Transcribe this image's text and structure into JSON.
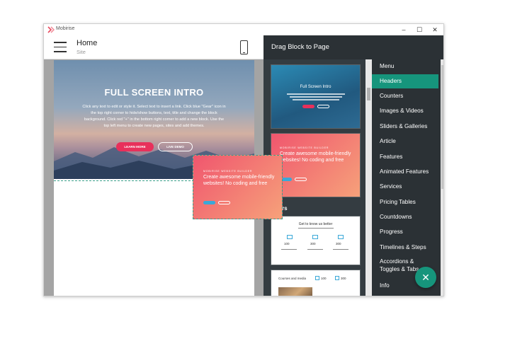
{
  "app": {
    "name": "Mobirise",
    "window_controls": {
      "minimize": "–",
      "maximize": "☐",
      "close": "✕"
    }
  },
  "editor": {
    "page_title": "Home",
    "page_subtitle": "Site",
    "hero": {
      "title": "FULL SCREEN INTRO",
      "text": "Click any text to edit or style it. Select text to insert a link. Click blue \"Gear\" icon in the top right corner to hide/show buttons, text, title and change the block background. Click red \"+\" in the bottom right corner to add a new block. Use the top left menu to create new pages, sites and add themes.",
      "primary_button": "LEARN MORE",
      "secondary_button": "LIVE DEMO"
    }
  },
  "dragged_block": {
    "supertitle": "MOBIRISE WEBSITE BUILDER",
    "title": "Create awesome mobile-friendly websites! No coding and free"
  },
  "panel": {
    "title": "Drag Block to Page",
    "thumbnails": [
      {
        "title": "Full Screen Intro"
      },
      {
        "supertitle": "MOBIRISE WEBSITE BUILDER",
        "title": "Create awesome mobile-friendly websites! No coding and free"
      },
      {
        "title": "Get to know us better",
        "stats": [
          "100",
          "300",
          "300"
        ]
      },
      {
        "title": "Courses and media",
        "stats": [
          "100",
          "300"
        ]
      }
    ],
    "section_label": "nters",
    "categories": [
      "Menu",
      "Headers",
      "Counters",
      "Images & Videos",
      "Sliders & Galleries",
      "Article",
      "Features",
      "Animated Features",
      "Services",
      "Pricing Tables",
      "Countdowns",
      "Progress",
      "Timelines & Steps",
      "Accordions & Toggles & Tabs",
      "Info"
    ],
    "active_category": "Headers",
    "fab_icon": "close-icon"
  },
  "colors": {
    "accent": "#16957c",
    "primary_button": "#e8305b",
    "panel_bg": "#2b3135"
  }
}
